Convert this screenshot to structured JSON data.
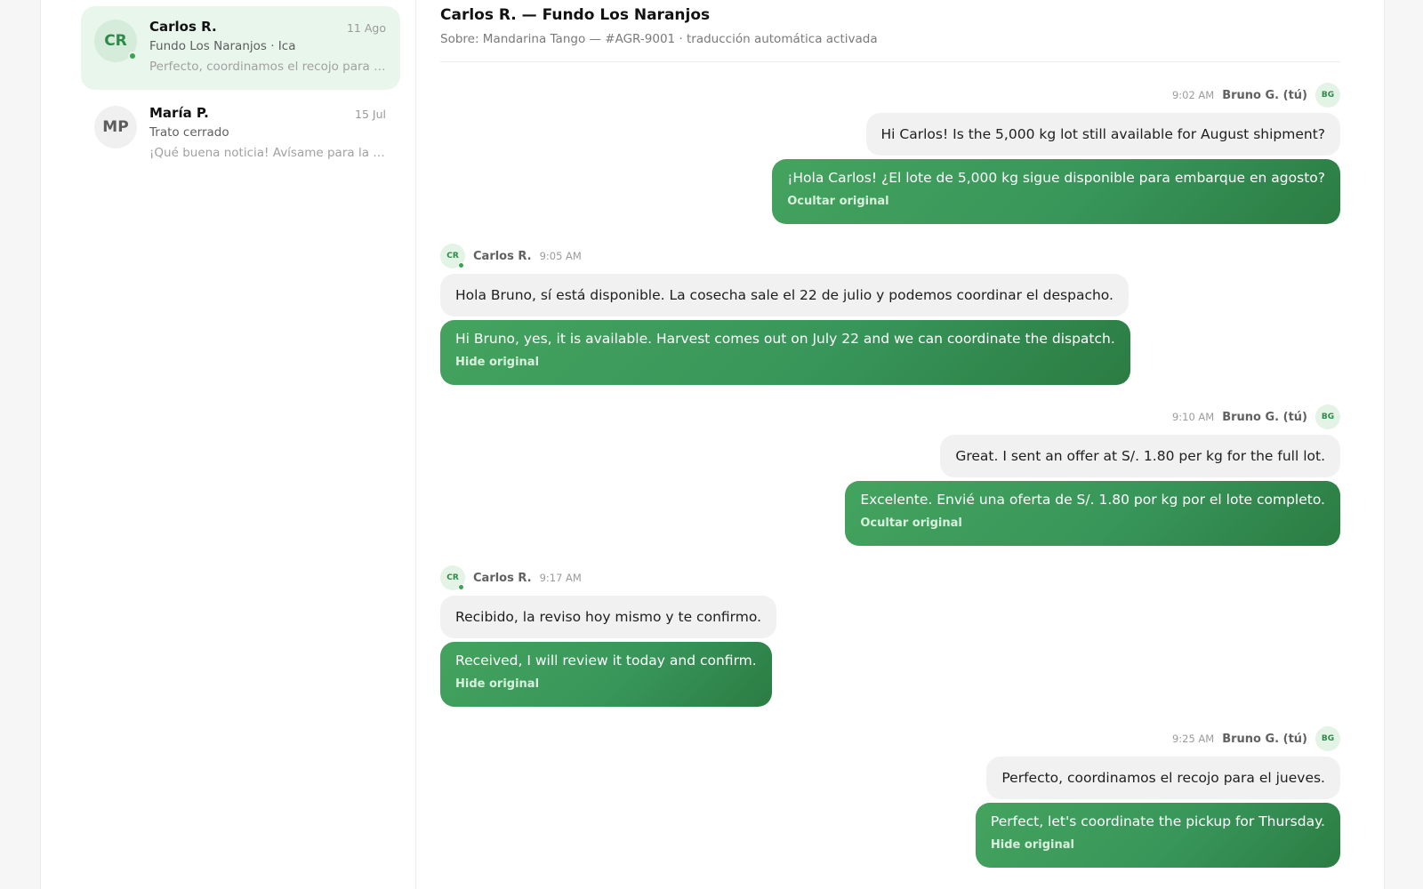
{
  "conversations": [
    {
      "initials": "CR",
      "name": "Carlos R.",
      "date": "11 Ago",
      "subtitle": "Fundo Los Naranjos · Ica",
      "preview": "Perfecto, coordinamos el recojo para el jueves.",
      "active": true,
      "online": true
    },
    {
      "initials": "MP",
      "name": "María P.",
      "date": "15 Jul",
      "subtitle": "Trato cerrado",
      "preview": "¡Qué buena noticia! Avísame para la próxima cosecha.",
      "active": false,
      "online": false
    }
  ],
  "chat": {
    "title": "Carlos R. — Fundo Los Naranjos",
    "subtitle": "Sobre: Mandarina Tango — #AGR-9001 · traducción automática activada"
  },
  "messages": [
    {
      "time": "9:02 AM",
      "author": "Bruno G. (tú)",
      "initials": "BG",
      "original": "Hi Carlos! Is the 5,000 kg lot still available for August shipment?",
      "translation": "¡Hola Carlos! ¿El lote de 5,000 kg sigue disponible para embarque en agosto?",
      "toggle": "Ocultar original"
    },
    {
      "time": "9:05 AM",
      "author": "Carlos R.",
      "initials": "CR",
      "original": "Hola Bruno, sí está disponible. La cosecha sale el 22 de julio y podemos coordinar el despacho.",
      "translation": "Hi Bruno, yes, it is available. Harvest comes out on July 22 and we can coordinate the dispatch.",
      "toggle": "Hide original"
    },
    {
      "time": "9:10 AM",
      "author": "Bruno G. (tú)",
      "initials": "BG",
      "original": "Great. I sent an offer at S/. 1.80 per kg for the full lot.",
      "translation": "Excelente. Envié una oferta de S/. 1.80 por kg por el lote completo.",
      "toggle": "Ocultar original"
    },
    {
      "time": "9:17 AM",
      "author": "Carlos R.",
      "initials": "CR",
      "original": "Recibido, la reviso hoy mismo y te confirmo.",
      "translation": "Received, I will review it today and confirm.",
      "toggle": "Hide original"
    },
    {
      "time": "9:25 AM",
      "author": "Bruno G. (tú)",
      "initials": "BG",
      "original": "Perfecto, coordinamos el recojo para el jueves.",
      "translation": "Perfect, let's coordinate the pickup for Thursday.",
      "toggle": "Hide original"
    }
  ],
  "colors": {
    "accent_green": "#3aa255",
    "bubble_green_start": "#44a35e",
    "bubble_green_end": "#2b7c43",
    "active_conversation_bg": "#e9f6ec",
    "bubble_grey": "#f1f1f1"
  }
}
